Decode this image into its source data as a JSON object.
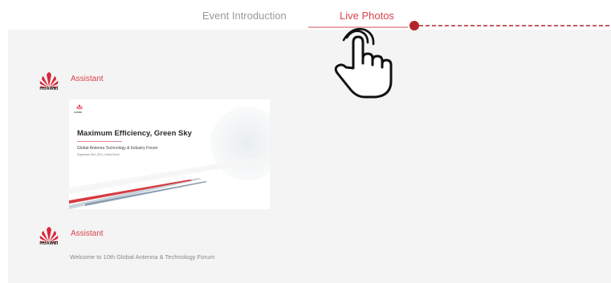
{
  "tabs": [
    {
      "label": "Event Introduction"
    },
    {
      "label": "Live Photos"
    }
  ],
  "feed": [
    {
      "brand": "HUAWEI",
      "sender": "Assistant"
    },
    {
      "brand": "HUAWEI",
      "sender": "Assistant",
      "message": "Welcome to 10th Global Antenna & Technology Forum"
    }
  ],
  "photo": {
    "brand": "HUAWEI",
    "title": "Maximum Efficiency, Green Sky",
    "subtitle": "Global Antenna Technology & Industry Forum",
    "date_line": "September 23rd, 2021 | Online Event"
  },
  "colors": {
    "accent": "#d9424a",
    "panel": "#f4f4f4",
    "muted_text": "#9a9a9a"
  },
  "icons": [
    "huawei-logo",
    "hand-pointer-icon"
  ]
}
